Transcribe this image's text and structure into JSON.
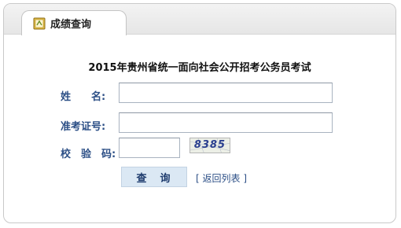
{
  "tab": {
    "label": "成绩查询",
    "icon": "notebook-icon"
  },
  "form": {
    "title": "2015年贵州省统一面向社会公开招考公务员考试",
    "name_label": "姓　　名:",
    "name_value": "",
    "ticket_label": "准考证号:",
    "ticket_value": "",
    "captcha_label": "校　验　码:",
    "captcha_value": "",
    "captcha_text": "8385",
    "query_button": "查　询",
    "back_link": "返回列表",
    "back_open": "[",
    "back_close": "]"
  },
  "colors": {
    "label": "#2c4f86",
    "button_bg": "#dbe8f4",
    "panel_border": "#c9c9c9"
  }
}
